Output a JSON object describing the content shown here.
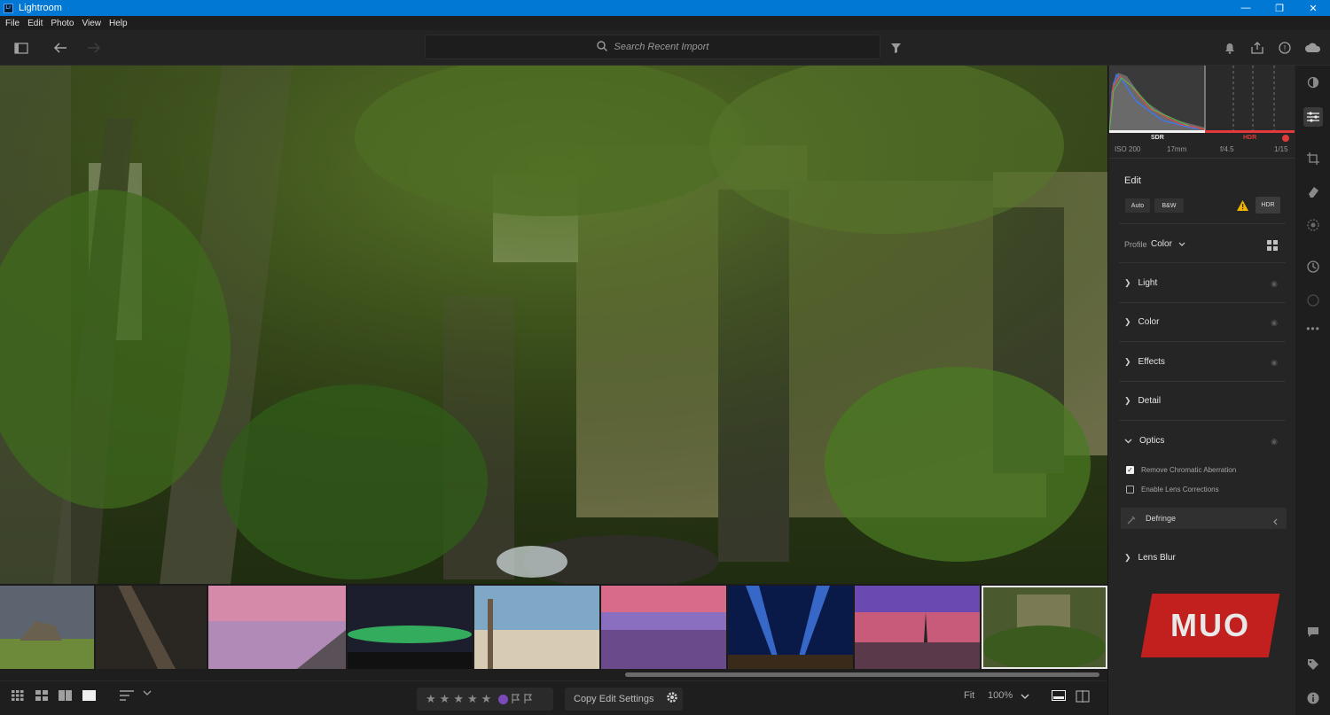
{
  "window": {
    "app_icon": "Lr",
    "title": "Lightroom",
    "minimize": "—",
    "maximize": "❐",
    "close": "✕"
  },
  "menu": [
    "File",
    "Edit",
    "Photo",
    "View",
    "Help"
  ],
  "search": {
    "placeholder": "Search Recent Import"
  },
  "histogram": {
    "sdr": "SDR",
    "hdr": "HDR"
  },
  "exif": {
    "iso": "ISO 200",
    "focal": "17mm",
    "aperture": "f/4.5",
    "shutter": "1/15"
  },
  "edit": {
    "title": "Edit",
    "auto": "Auto",
    "bw": "B&W",
    "hdr": "HDR",
    "profile_label": "Profile",
    "profile_value": "Color",
    "sections": [
      "Light",
      "Color",
      "Effects",
      "Detail",
      "Optics"
    ],
    "optics": {
      "remove_ca": "Remove Chromatic Aberration",
      "remove_ca_checked": true,
      "lens_corrections": "Enable Lens Corrections",
      "lens_corrections_checked": false,
      "defringe": "Defringe"
    },
    "lens_blur": "Lens Blur"
  },
  "bottom": {
    "copy_settings": "Copy Edit Settings",
    "fit": "Fit",
    "zoom": "100%",
    "stars": [
      "★",
      "★",
      "★",
      "★",
      "★"
    ]
  },
  "watermark": "MUO",
  "colors": {
    "titlebar": "#0078d4",
    "panel": "#252525",
    "accent_warn": "#f0b400",
    "hdr_red": "#e03a3a"
  },
  "thumbnails": [
    "castle-ruin",
    "milky-way",
    "pink-lake-jetty",
    "aurora-lake",
    "beach-signpost",
    "lavender-field",
    "city-light-beams",
    "sunset-tree",
    "rainforest-ruins"
  ]
}
